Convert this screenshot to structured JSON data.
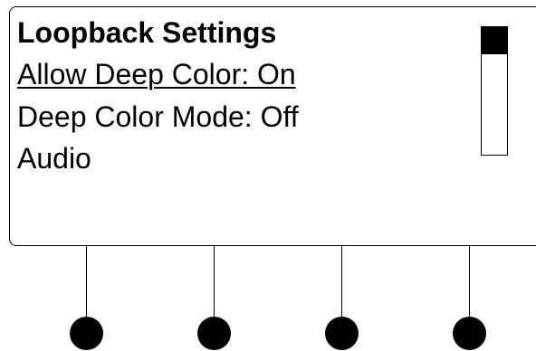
{
  "display": {
    "title": "Loopback Settings",
    "items": [
      {
        "label": "Allow Deep Color: On",
        "selected": true
      },
      {
        "label": "Deep Color Mode: Off",
        "selected": false
      },
      {
        "label": "Audio",
        "selected": false
      }
    ]
  },
  "scrollbar": {
    "position_fraction": 0.0
  },
  "softkeys": [
    {
      "name": "softkey-1"
    },
    {
      "name": "softkey-2"
    },
    {
      "name": "softkey-3"
    },
    {
      "name": "softkey-4"
    }
  ]
}
